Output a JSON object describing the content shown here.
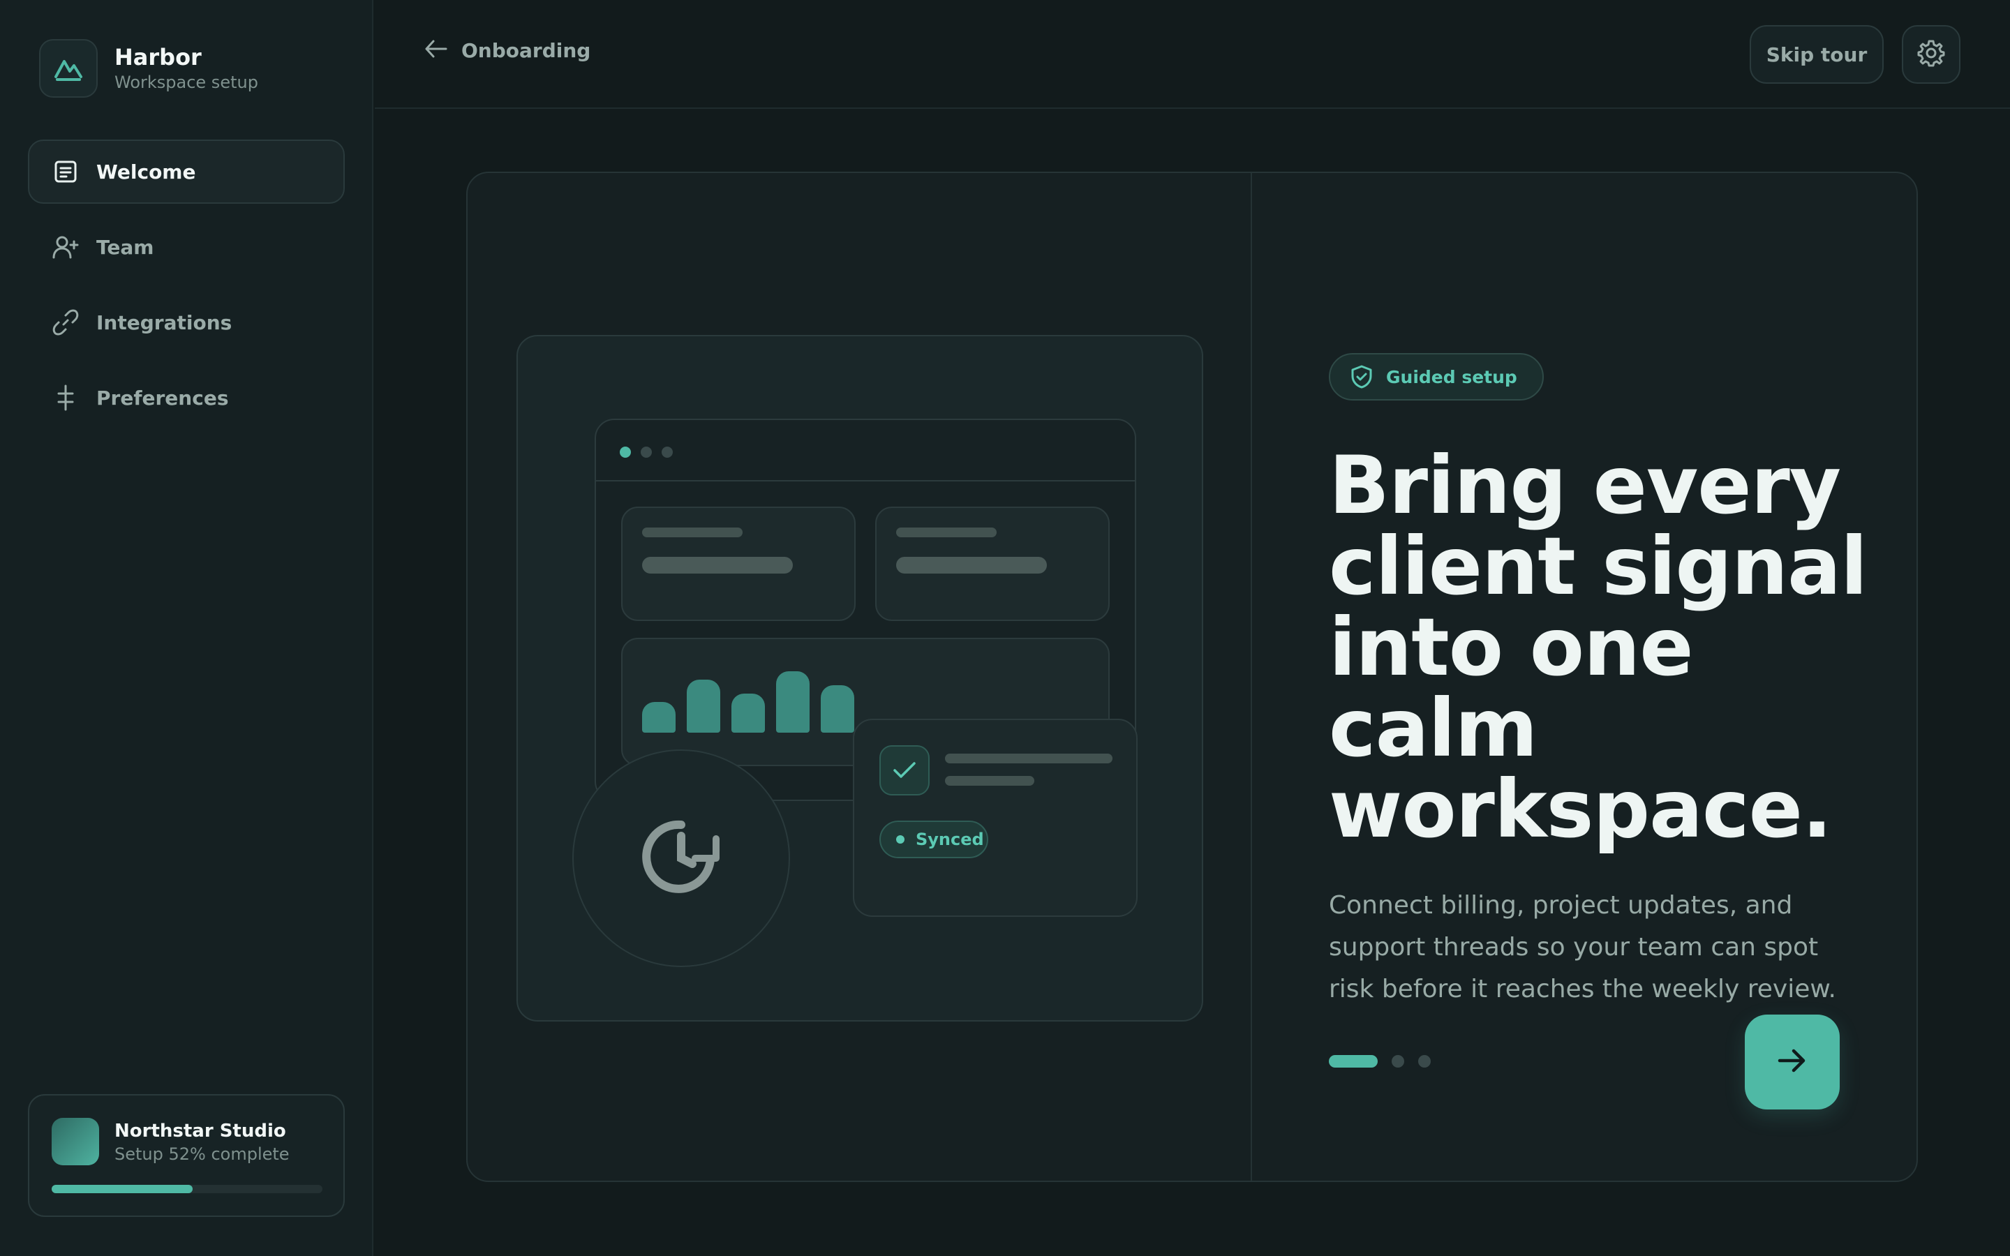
{
  "brand": {
    "name": "Harbor",
    "subtitle": "Workspace setup"
  },
  "sidebar": {
    "items": [
      {
        "label": "Welcome",
        "icon": "document-icon",
        "active": true
      },
      {
        "label": "Team",
        "icon": "user-plus-icon",
        "active": false
      },
      {
        "label": "Integrations",
        "icon": "link-icon",
        "active": false
      },
      {
        "label": "Preferences",
        "icon": "sliders-icon",
        "active": false
      }
    ]
  },
  "workspace": {
    "name": "Northstar Studio",
    "progress_text": "Setup 52% complete",
    "progress": 0.52
  },
  "header": {
    "back_label": "Onboarding",
    "skip_label": "Skip tour",
    "settings_icon": "gear-icon"
  },
  "hero": {
    "badge": "Guided setup",
    "headline": "Bring every client signal into one calm workspace.",
    "body": "Connect billing, project updates, and support threads so your team can spot risk before it reaches the weekly review.",
    "step_current": 1,
    "step_total": 3,
    "next_icon": "arrow-right-icon"
  },
  "illustration": {
    "status_pill": "Synced"
  },
  "colors": {
    "accent": "#4fb9a5",
    "background": "#121b1c",
    "sidebar": "#152022"
  }
}
